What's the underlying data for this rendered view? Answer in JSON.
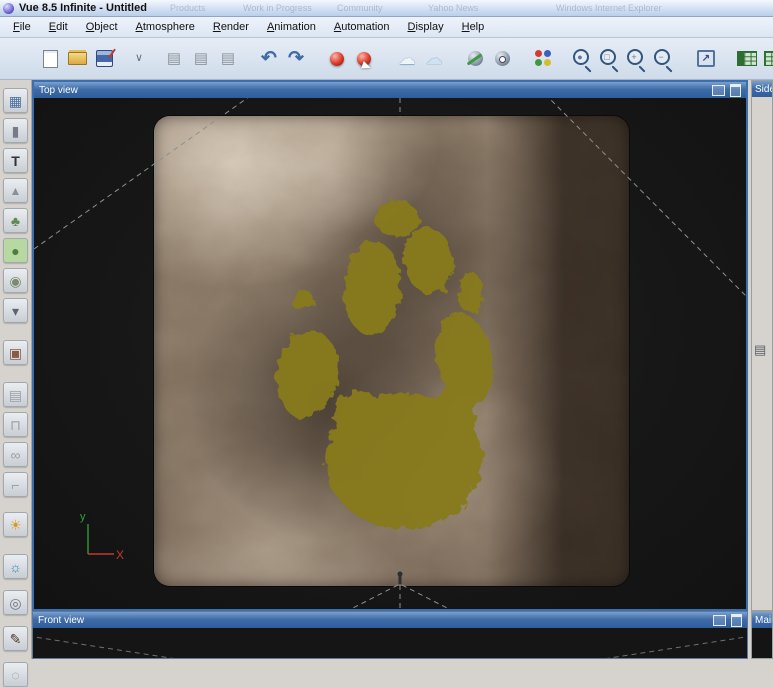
{
  "window": {
    "title": "Vue 8.5 Infinite - Untitled",
    "ghost_text": [
      "Products",
      "Work in Progress",
      "Community",
      "Yahoo News",
      "Windows Internet Explorer"
    ]
  },
  "menu": {
    "items": [
      {
        "name": "menu-file",
        "label": "File"
      },
      {
        "name": "menu-edit",
        "label": "Edit"
      },
      {
        "name": "menu-object",
        "label": "Object"
      },
      {
        "name": "menu-atmosphere",
        "label": "Atmosphere"
      },
      {
        "name": "menu-render",
        "label": "Render"
      },
      {
        "name": "menu-animation",
        "label": "Animation"
      },
      {
        "name": "menu-automation",
        "label": "Automation"
      },
      {
        "name": "menu-display",
        "label": "Display"
      },
      {
        "name": "menu-help",
        "label": "Help"
      }
    ]
  },
  "toolbar": {
    "items": [
      {
        "name": "new-scene-button",
        "glyph": "",
        "cls": "tb ic-page"
      },
      {
        "name": "open-button",
        "glyph": "",
        "cls": "tb ic-folder"
      },
      {
        "name": "save-button",
        "glyph": "",
        "cls": "tb ic-save"
      },
      {
        "name": "expand-chevron",
        "glyph": "∨",
        "cls": "tb glyph chev"
      },
      {
        "name": "copy-button",
        "glyph": "▤",
        "cls": "tb glyph g-gray"
      },
      {
        "name": "duplicate-button",
        "glyph": "▤",
        "cls": "tb glyph g-gray"
      },
      {
        "name": "delete-button",
        "glyph": "▤",
        "cls": "tb glyph g-gray"
      },
      {
        "name": "undo-button",
        "glyph": "↶",
        "cls": "tb glyph g-blue"
      },
      {
        "name": "redo-button",
        "glyph": "↷",
        "cls": "tb glyph g-blue"
      },
      {
        "name": "render-button",
        "glyph": "",
        "cls": "tb ball-red"
      },
      {
        "name": "render-pick-button",
        "glyph": "",
        "cls": "tb ball-red render-pick"
      },
      {
        "name": "ecosystem-clouds-button",
        "glyph": "☁",
        "cls": "tb glyph g-cloud"
      },
      {
        "name": "cloud-button",
        "glyph": "☁",
        "cls": "tb glyph g-cloud2"
      },
      {
        "name": "paint-sphere-button",
        "glyph": "",
        "cls": "tb sphere-paint"
      },
      {
        "name": "inspect-sphere-button",
        "glyph": "",
        "cls": "tb sphere-eye"
      },
      {
        "name": "materials-button",
        "glyph": "",
        "cls": "tb balls"
      },
      {
        "name": "zoom-sphere-button",
        "glyph": "●",
        "cls": "tb mag"
      },
      {
        "name": "zoom-region-button",
        "glyph": "□",
        "cls": "tb mag"
      },
      {
        "name": "zoom-in-button",
        "glyph": "+",
        "cls": "tb mag"
      },
      {
        "name": "zoom-out-button",
        "glyph": "−",
        "cls": "tb mag"
      },
      {
        "name": "export-view-button",
        "glyph": "↗",
        "cls": "tb ic-export"
      },
      {
        "name": "layout-quad-button",
        "glyph": "",
        "cls": "tb grid-ic alt"
      },
      {
        "name": "layout-split-button",
        "glyph": "",
        "cls": "tb grid-ic"
      }
    ]
  },
  "left_toolbar": {
    "items": [
      {
        "name": "terrain-tool",
        "glyph": "▦",
        "style": "color:#4a6fa0"
      },
      {
        "name": "cylinder-tool",
        "glyph": "▮",
        "style": "color:#757c85"
      },
      {
        "name": "text-tool",
        "glyph": "T",
        "style": "color:#2f343a;font-weight:bold"
      },
      {
        "name": "cone-tool",
        "glyph": "▲",
        "style": "color:#8a9098;font-size:12px"
      },
      {
        "name": "plant-tool",
        "glyph": "♣",
        "style": "color:#5f8a52"
      },
      {
        "name": "rock-tool",
        "glyph": "●",
        "style": "color:#4e7c3c;background:#b7d8a1"
      },
      {
        "name": "sphere-tool",
        "glyph": "◉",
        "style": "color:#7c8a70"
      },
      {
        "name": "water-drop-tool",
        "glyph": "▾",
        "style": "color:#5d6670"
      },
      {
        "name": "load-object-tool",
        "glyph": "▣",
        "style": "color:#8a5b44"
      },
      {
        "name": "group-tool",
        "glyph": "▤",
        "style": "color:#9aa0a8"
      },
      {
        "name": "magnet-tool",
        "glyph": "⊓",
        "style": "color:#9aa0a8"
      },
      {
        "name": "link-tool",
        "glyph": "∞",
        "style": "color:#9aa0a8"
      },
      {
        "name": "pipe-tool",
        "glyph": "⌐",
        "style": "color:#9aa0a8"
      },
      {
        "name": "light-tool",
        "glyph": "☀",
        "style": "color:#d79a18"
      },
      {
        "name": "planet-tool",
        "glyph": "☼",
        "style": "color:#2f8aa8"
      },
      {
        "name": "camera-tool",
        "glyph": "◎",
        "style": "color:#6d7680"
      },
      {
        "name": "brush-tool",
        "glyph": "✎",
        "style": "color:#4a3a2c"
      },
      {
        "name": "rings-tool",
        "glyph": "◌",
        "style": "color:#8a9098"
      }
    ]
  },
  "viewports": {
    "top": {
      "title": "Top view"
    },
    "front": {
      "title": "Front view"
    },
    "side": {
      "title": "Side"
    },
    "main": {
      "title": "Main"
    }
  },
  "axis": {
    "y_label": "y",
    "x_label": "X"
  },
  "colors": {
    "viewport_titlebar": "#3f6ca8",
    "active_border": "#3a6fb0",
    "terrain_base": "#8b7a69",
    "paw_print": "#877a1e",
    "axis_y": "#35a035",
    "axis_x": "#c03a2f"
  }
}
